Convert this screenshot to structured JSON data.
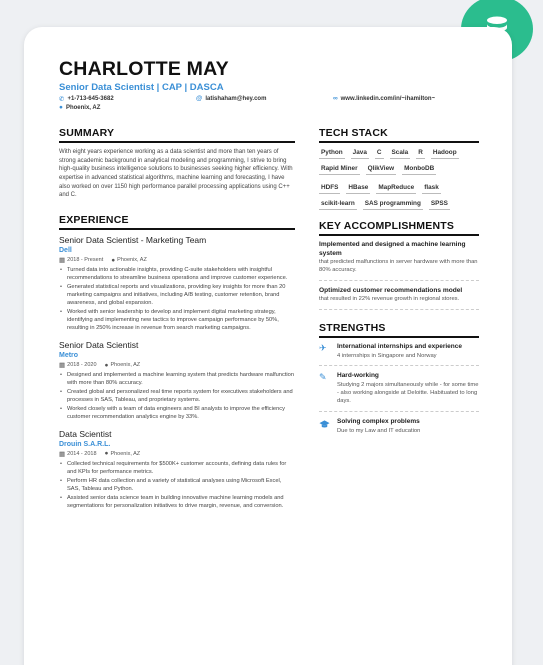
{
  "header": {
    "name": "CHARLOTTE MAY",
    "title": "Senior Data Scientist | CAP | DASCA",
    "phone": "+1-713-645-3682",
    "email": "latishaham@hey.com",
    "linkedin": "www.linkedin.com/in/~ihamilton~",
    "location": "Phoenix, AZ"
  },
  "summary": {
    "title": "SUMMARY",
    "text": "With eight years experience working as a data scientist and more than ten years of strong academic background in analytical modeling and programming, I strive to bring high-quality business intelligence solutions to businesses seeking higher efficiency. With expertise in advanced statistical algorithms, machine learning and forecasting, I have also worked on over 1150 high performance parallel processing applications using C++ and C."
  },
  "experience": {
    "title": "EXPERIENCE",
    "jobs": [
      {
        "role": "Senior Data Scientist - Marketing Team",
        "company": "Dell",
        "dates": "2018 - Present",
        "location": "Phoenix, AZ",
        "bullets": [
          "Turned data into actionable insights, providing C-suite stakeholders with insightful recommendations to streamline business operations and improve customer experience.",
          "Generated statistical reports and visualizations, providing key insights for more than 20 marketing campaigns and initiatives, including A/B testing, customer retention, brand awareness, and global expansion.",
          "Worked with senior leadership to develop and implement digital marketing strategy, identifying and implementing new tactics to improve campaign performance by 50%, resulting in 250% increase in revenue from search marketing campaigns."
        ]
      },
      {
        "role": "Senior Data Scientist",
        "company": "Metro",
        "dates": "2018 - 2020",
        "location": "Phoenix, AZ",
        "bullets": [
          "Designed and implemented a machine learning system that predicts hardware malfunction with more than 80% accuracy.",
          "Created global and personalized real time reports system for executives stakeholders and processes in SAS, Tableau, and proprietary systems.",
          "Worked closely with a team of data engineers and BI analysts to improve the efficiency customer recommendation analytics engine by 33%."
        ]
      },
      {
        "role": "Data Scientist",
        "company": "Drouin S.A.R.L.",
        "dates": "2014 - 2018",
        "location": "Phoenix, AZ",
        "bullets": [
          "Collected technical requirements for $500K+ customer accounts, defining data rules for and KPIs for performance metrics.",
          "Perform HR data collection and a variety of statistical analyses using Microsoft Excel, SAS, Tableau and Python.",
          "Assisted senior data science team in building innovative machine learning models and segmentations for personalization initiatives to drive margin, revenue, and conversion."
        ]
      }
    ]
  },
  "tech": {
    "title": "TECH STACK",
    "rows": [
      [
        "Python",
        "Java",
        "C",
        "Scala",
        "R"
      ],
      [
        "Hadoop",
        "Rapid Miner",
        "QlikView"
      ],
      [
        "MonboDB"
      ],
      [
        "HDFS",
        "HBase",
        "MapReduce"
      ],
      [
        "flask",
        "scikit-learn"
      ],
      [
        "SAS programming",
        "SPSS"
      ]
    ]
  },
  "accomplishments": {
    "title": "KEY ACCOMPLISHMENTS",
    "items": [
      {
        "title": "Implemented and designed a machine learning system",
        "desc": "that predicted malfunctions in server hardware with more than 80% accuracy."
      },
      {
        "title": "Optimized customer recommendations model",
        "desc": "that resulted in 22% revenue growth in regional stores."
      }
    ]
  },
  "strengths": {
    "title": "STRENGTHS",
    "items": [
      {
        "icon": "airplane-icon",
        "title": "International internships and experience",
        "desc": "4 internships in Singapore and Norway"
      },
      {
        "icon": "pen-icon",
        "title": "Hard-working",
        "desc": "Studying 2 majors simultaneously while - for some time - also working alongside at Deloitte. Habituated to long days."
      },
      {
        "icon": "graduation-cap-icon",
        "title": "Solving complex problems",
        "desc": "Due to my Law and IT education"
      }
    ]
  }
}
